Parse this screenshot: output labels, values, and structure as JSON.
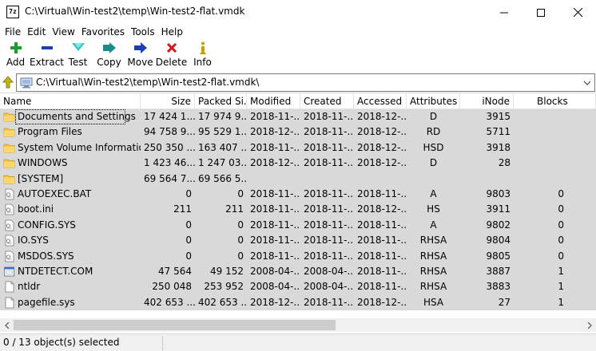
{
  "window": {
    "app_icon_text": "7z",
    "title": "C:\\Virtual\\Win-test2\\temp\\Win-test2-flat.vmdk"
  },
  "menu": [
    "File",
    "Edit",
    "View",
    "Favorites",
    "Tools",
    "Help"
  ],
  "toolbar": {
    "add": "Add",
    "extract": "Extract",
    "test": "Test",
    "copy": "Copy",
    "move": "Move",
    "delete": "Delete",
    "info": "Info"
  },
  "address": {
    "path": "C:\\Virtual\\Win-test2\\temp\\Win-test2-flat.vmdk\\"
  },
  "columns": {
    "name": "Name",
    "size": "Size",
    "packed": "Packed Si...",
    "modified": "Modified",
    "created": "Created",
    "accessed": "Accessed",
    "attributes": "Attributes",
    "inode": "iNode",
    "blocks": "Blocks"
  },
  "rows": [
    {
      "icon": "folder",
      "name": "Documents and Settings",
      "size": "17 424 1...",
      "packed": "17 974 9...",
      "modified": "2018-11-...",
      "created": "2018-11-...",
      "accessed": "2018-12-...",
      "attributes": "D",
      "inode": "3915",
      "blocks": ""
    },
    {
      "icon": "folder",
      "name": "Program Files",
      "size": "94 758 9...",
      "packed": "95 529 1...",
      "modified": "2018-12-...",
      "created": "2018-11-...",
      "accessed": "2018-12-...",
      "attributes": "RD",
      "inode": "5711",
      "blocks": ""
    },
    {
      "icon": "folder",
      "name": "System Volume Information",
      "size": "250 350 ...",
      "packed": "163 407 ...",
      "modified": "2018-11-...",
      "created": "2018-11-...",
      "accessed": "2018-12-...",
      "attributes": "HSD",
      "inode": "3918",
      "blocks": ""
    },
    {
      "icon": "folder",
      "name": "WINDOWS",
      "size": "1 423 46...",
      "packed": "1 247 03...",
      "modified": "2018-12-...",
      "created": "2018-11-...",
      "accessed": "2018-12-...",
      "attributes": "D",
      "inode": "28",
      "blocks": ""
    },
    {
      "icon": "folder",
      "name": "[SYSTEM]",
      "size": "69 564 7...",
      "packed": "69 566 5...",
      "modified": "",
      "created": "",
      "accessed": "",
      "attributes": "",
      "inode": "",
      "blocks": ""
    },
    {
      "icon": "file-config",
      "name": "AUTOEXEC.BAT",
      "size": "0",
      "packed": "0",
      "modified": "2018-11-...",
      "created": "2018-11-...",
      "accessed": "2018-11-...",
      "attributes": "A",
      "inode": "9803",
      "blocks": "0"
    },
    {
      "icon": "file-config",
      "name": "boot.ini",
      "size": "211",
      "packed": "211",
      "modified": "2018-11-...",
      "created": "2018-11-...",
      "accessed": "2018-12-...",
      "attributes": "HS",
      "inode": "3911",
      "blocks": "0"
    },
    {
      "icon": "file-config",
      "name": "CONFIG.SYS",
      "size": "0",
      "packed": "0",
      "modified": "2018-11-...",
      "created": "2018-11-...",
      "accessed": "2018-11-...",
      "attributes": "A",
      "inode": "9802",
      "blocks": "0"
    },
    {
      "icon": "file-config",
      "name": "IO.SYS",
      "size": "0",
      "packed": "0",
      "modified": "2018-11-...",
      "created": "2018-11-...",
      "accessed": "2018-11-...",
      "attributes": "RHSA",
      "inode": "9804",
      "blocks": "0"
    },
    {
      "icon": "file-config",
      "name": "MSDOS.SYS",
      "size": "0",
      "packed": "0",
      "modified": "2018-11-...",
      "created": "2018-11-...",
      "accessed": "2018-11-...",
      "attributes": "RHSA",
      "inode": "9805",
      "blocks": "0"
    },
    {
      "icon": "file-exe",
      "name": "NTDETECT.COM",
      "size": "47 564",
      "packed": "49 152",
      "modified": "2008-04-...",
      "created": "2008-04-...",
      "accessed": "2018-11-...",
      "attributes": "RHSA",
      "inode": "3887",
      "blocks": "1"
    },
    {
      "icon": "file-plain",
      "name": "ntldr",
      "size": "250 048",
      "packed": "253 952",
      "modified": "2008-04-...",
      "created": "2008-04-...",
      "accessed": "2018-11-...",
      "attributes": "RHSA",
      "inode": "3883",
      "blocks": "1"
    },
    {
      "icon": "file-plain",
      "name": "pagefile.sys",
      "size": "402 653 ...",
      "packed": "402 653 ...",
      "modified": "2018-12-...",
      "created": "2018-11-...",
      "accessed": "2018-12-...",
      "attributes": "HSA",
      "inode": "27",
      "blocks": "1"
    }
  ],
  "status": {
    "text": "0 / 13 object(s) selected"
  },
  "colors": {
    "row_bg": "#d9d9d9",
    "folder": "#f5c342",
    "add_green": "#1f9b2f",
    "extract_blue": "#1b3fb0",
    "test_cyan": "#2ec6c6",
    "delete_red": "#d11a1a"
  }
}
